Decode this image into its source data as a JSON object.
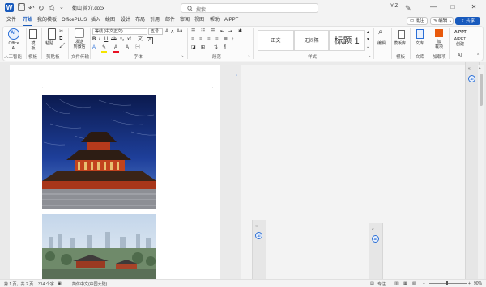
{
  "titlebar": {
    "app_logo": "W",
    "document_title": "衢山 简介.docx",
    "search_placeholder": "搜索",
    "user_initials": "Y Z",
    "window_minimize": "—",
    "window_maximize": "□",
    "window_close": "✕"
  },
  "tabs": [
    "文件",
    "开始",
    "我的模板",
    "OfficePLUS",
    "插入",
    "绘图",
    "设计",
    "布局",
    "引用",
    "邮件",
    "审阅",
    "视图",
    "帮助",
    "AIPPT"
  ],
  "active_tab_index": 1,
  "actions": {
    "comment": "批注",
    "edit": "编辑",
    "share": "共享"
  },
  "ribbon": {
    "ai_button": "Office\nAI",
    "ai_group": "人工智能",
    "template_button": "模\n板",
    "template_group": "模板",
    "paste_button": "粘贴",
    "clipboard_group": "剪贴板",
    "clipboard_label": "发送\n到微信",
    "wechat_group": "文件传输",
    "font_name": "等线 (中文正文)",
    "font_size": "五号",
    "font_group": "字体",
    "paragraph_group": "段落",
    "styles": [
      "正文",
      "无间隔",
      "标题 1"
    ],
    "styles_group": "样式",
    "edit_button": "编辑",
    "template_lib_button": "模板库",
    "template_lib_group": "模板",
    "doc_button": "文库",
    "doc_group": "文库",
    "addins_button": "加\n载项",
    "addins_group": "加载项",
    "aippt_button": "AIPPT\n创建",
    "ai_group2": "AI"
  },
  "statusbar": {
    "page": "第 1 页，共 2 页",
    "words": "314 个字",
    "language": "简体中文(中国大陆)",
    "focus": "专注",
    "zoom": "90%"
  },
  "colors": {
    "accent": "#185abd",
    "ai_blue": "#2b6fd6"
  }
}
